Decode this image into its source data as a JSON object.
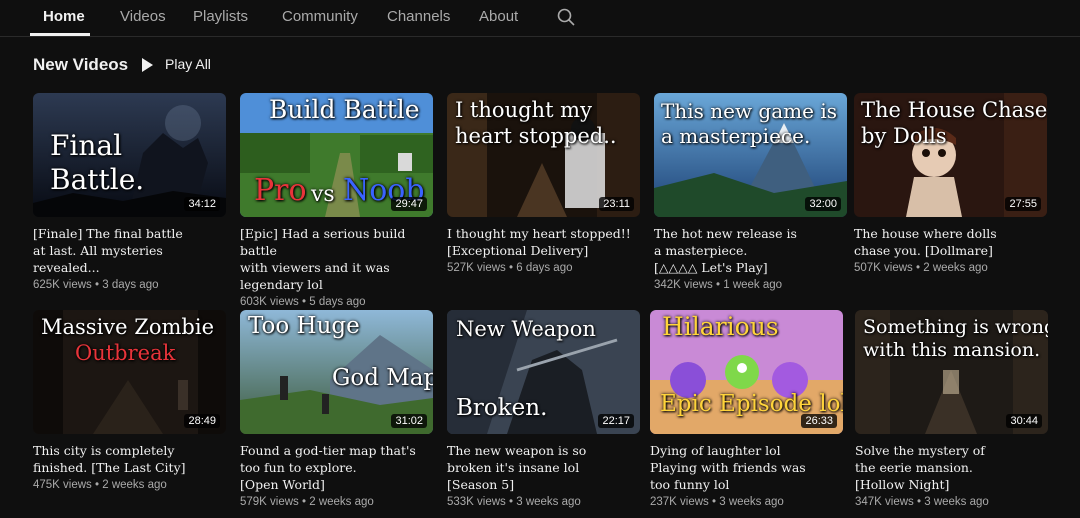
{
  "nav": {
    "tabs": [
      "Home",
      "Videos",
      "Playlists",
      "Community",
      "Channels",
      "About"
    ],
    "search_icon": "search-icon"
  },
  "section": {
    "title": "New Videos",
    "play_all": "Play All"
  },
  "videos": [
    {
      "overlay": [
        "Final",
        "Battle."
      ],
      "duration": "34:12",
      "title": "[Finale] The final battle\nat last. All mysteries revealed...",
      "views": "625K views",
      "age": "3 days ago"
    },
    {
      "overlay": [
        "Build Battle",
        "Pro",
        "vs",
        "Noob"
      ],
      "duration": "29:47",
      "title": "[Epic] Had a serious build battle\nwith viewers and it was\nlegendary lol",
      "views": "603K views",
      "age": "5 days ago"
    },
    {
      "overlay": [
        "I thought my",
        "heart stopped.."
      ],
      "duration": "23:11",
      "title": "I thought my heart stopped!!\n[Exceptional Delivery]",
      "views": "527K views",
      "age": "6 days ago"
    },
    {
      "overlay": [
        "This new game is",
        "a masterpiece."
      ],
      "duration": "32:00",
      "title": "The hot new release is\na masterpiece.\n[△△△△ Let's Play]",
      "views": "342K views",
      "age": "1 week ago"
    },
    {
      "overlay": [
        "The House Chased",
        "by Dolls"
      ],
      "duration": "27:55",
      "title": "The house where dolls\nchase you. [Dollmare]",
      "views": "507K views",
      "age": "2 weeks ago"
    },
    {
      "overlay": [
        "Massive Zombie",
        "Outbreak"
      ],
      "duration": "28:49",
      "title": "This city is completely\nfinished. [The Last City]",
      "views": "475K views",
      "age": "2 weeks ago"
    },
    {
      "overlay": [
        "Too Huge",
        "God Map"
      ],
      "duration": "31:02",
      "title": "Found a god-tier map that's\ntoo fun to explore.\n[Open World]",
      "views": "579K views",
      "age": "2 weeks ago"
    },
    {
      "overlay": [
        "New Weapon",
        "Broken."
      ],
      "duration": "22:17",
      "title": "The new weapon is so\nbroken it's insane lol\n[Season 5]",
      "views": "533K views",
      "age": "3 weeks ago"
    },
    {
      "overlay": [
        "Hilarious",
        "Epic Episode lol"
      ],
      "duration": "26:33",
      "title": "Dying of laughter lol\nPlaying with friends was\ntoo funny lol",
      "views": "237K views",
      "age": "3 weeks ago"
    },
    {
      "overlay": [
        "Something is wrong",
        "with this mansion."
      ],
      "duration": "30:44",
      "title": "Solve the mystery of\nthe eerie mansion.\n[Hollow Night]",
      "views": "347K views",
      "age": "3 weeks ago"
    }
  ],
  "colors": {
    "background": "#0f0f0f",
    "text": "#f1f1f1",
    "secondary": "#aaaaaa",
    "overlay_red": "#e8343a",
    "overlay_blue": "#3a63ff",
    "overlay_yellow": "#ffd43a"
  }
}
